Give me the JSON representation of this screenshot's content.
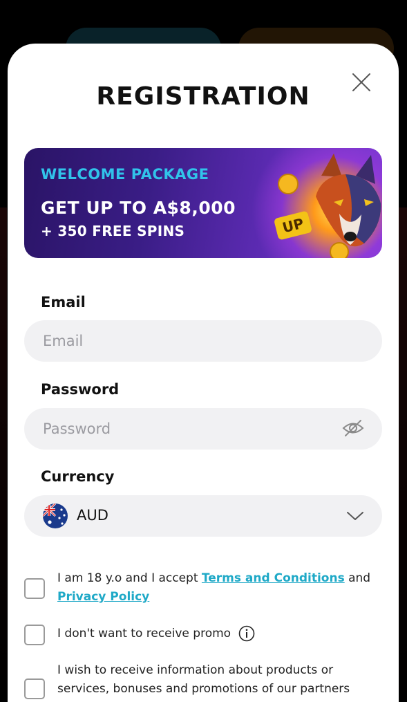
{
  "registration": {
    "title": "REGISTRATION",
    "banner": {
      "eyebrow": "WELCOME PACKAGE",
      "headline": "GET UP TO A$8,000",
      "subline": "+ 350 FREE SPINS",
      "badge_text": "UP"
    },
    "email": {
      "label": "Email",
      "placeholder": "Email",
      "value": ""
    },
    "password": {
      "label": "Password",
      "placeholder": "Password",
      "value": ""
    },
    "currency": {
      "label": "Currency",
      "value": "AUD",
      "flag": "australia-flag"
    },
    "consents": {
      "age": {
        "prefix": "I am 18 y.o and I accept ",
        "terms_link": "Terms and Conditions",
        "and": " and",
        "privacy_link": "Privacy Policy"
      },
      "promo": {
        "text": "I don't want to receive promo"
      },
      "partners": {
        "text": "I wish to receive information about products or services, bonuses and promotions of our partners"
      }
    },
    "colors": {
      "accent": "#31c3ea",
      "link": "#1fa9c7",
      "banner_start": "#2a1466",
      "banner_end": "#7a39d6"
    }
  }
}
